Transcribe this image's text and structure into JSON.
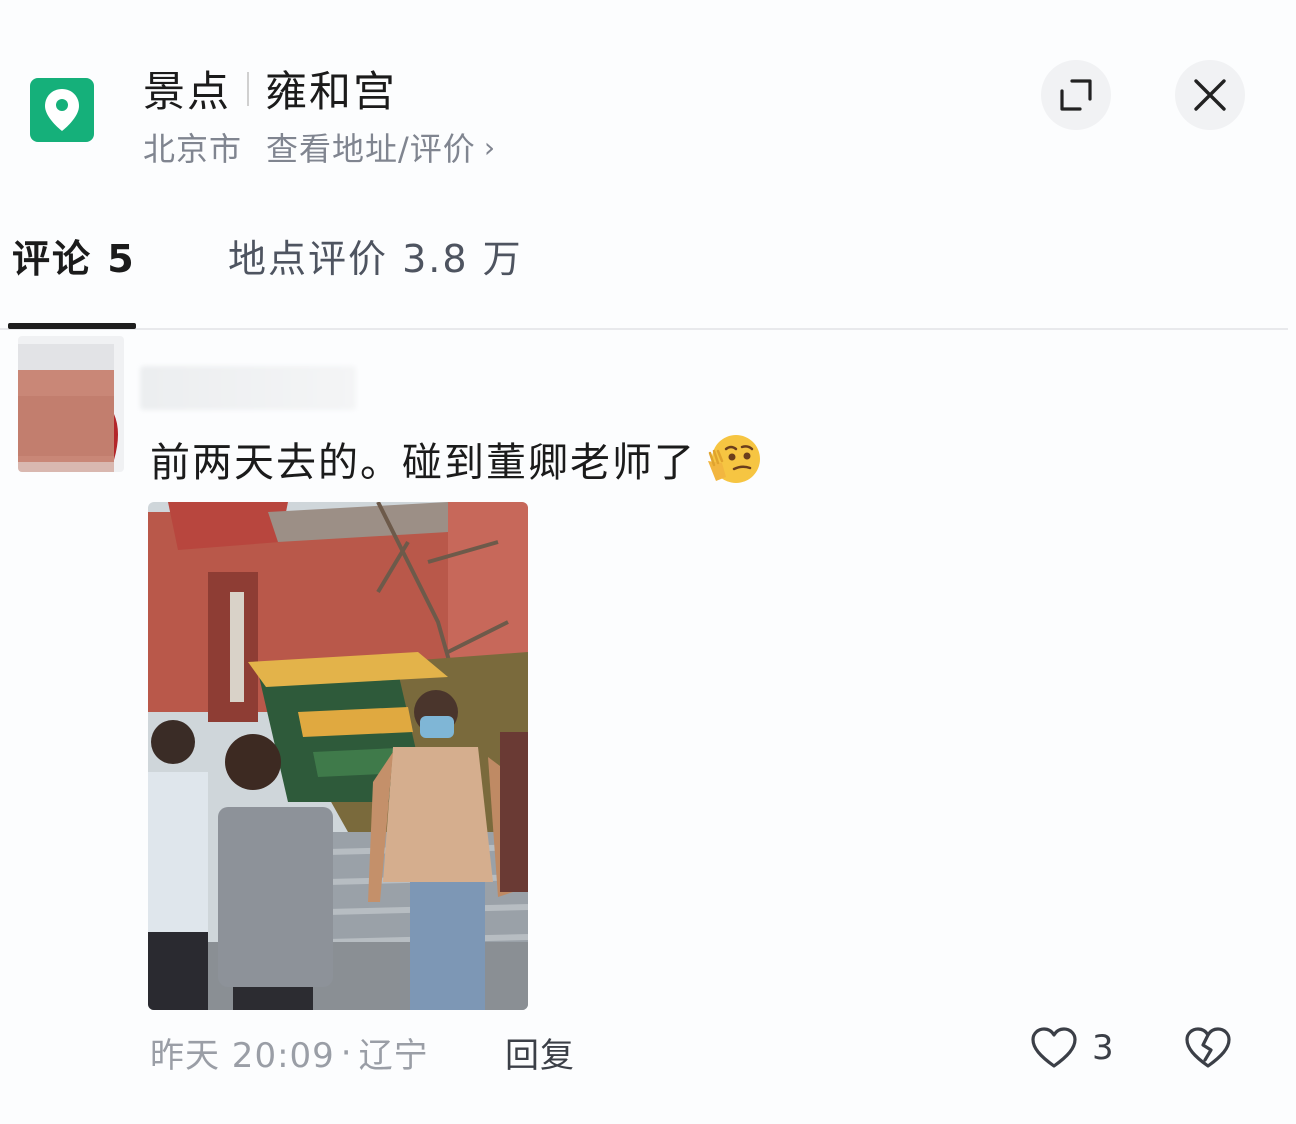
{
  "header": {
    "category": "景点",
    "place_name": "雍和宫",
    "city": "北京市",
    "address_link": "查看地址/评价",
    "chevron": "›"
  },
  "tabs": [
    {
      "label": "评论 5",
      "active": true
    },
    {
      "label": "地点评价 3.8 万",
      "active": false
    }
  ],
  "comment": {
    "text": "前两天去的。碰到董卿老师了",
    "time": "昨天 20:09",
    "separator": "·",
    "location": "辽宁",
    "reply_label": "回复",
    "like_count": "3"
  },
  "icons": {
    "location": "location-pin-icon",
    "expand": "expand-icon",
    "close": "close-icon",
    "like": "heart-outline-icon",
    "dislike": "broken-heart-icon",
    "emoji": "thinking-face-emoji-icon"
  },
  "colors": {
    "brand_green": "#15b07a",
    "text_primary": "#1b1b1b",
    "text_secondary": "#808590",
    "muted": "#9a9ea6"
  }
}
